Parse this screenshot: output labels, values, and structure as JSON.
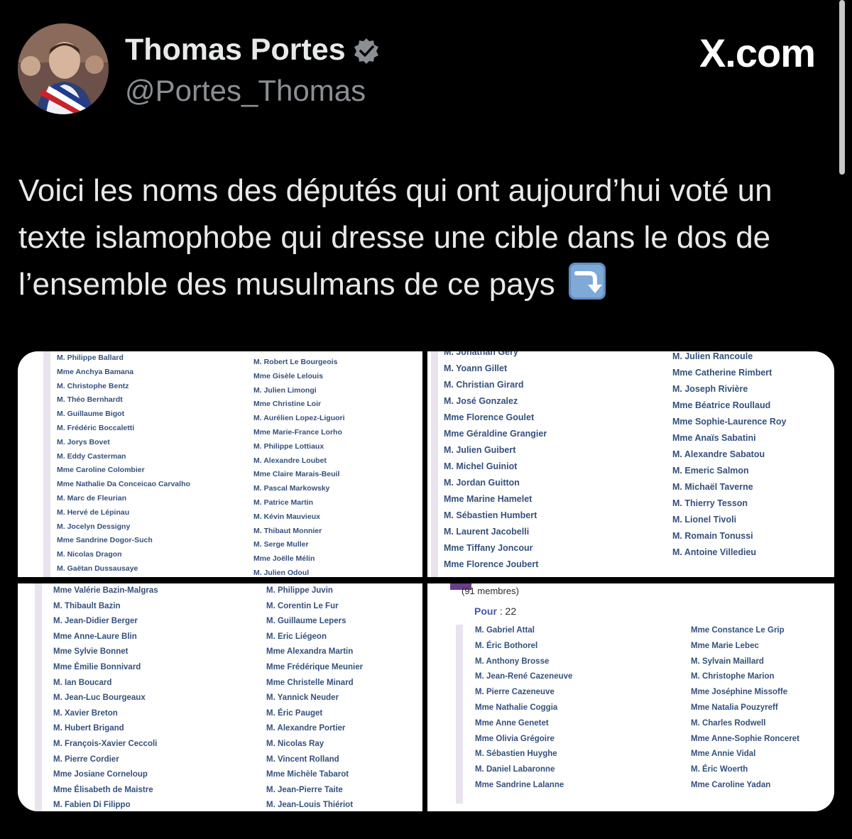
{
  "profile": {
    "display_name": "Thomas Portes",
    "handle": "@Portes_Thomas",
    "verified": true,
    "verified_icon": "verified-badge-icon"
  },
  "brand": "X.com",
  "tweet": {
    "text": "Voici les noms des députés qui ont aujourd’hui voté un texte islamophobe qui dresse une cible dans le dos de l’ensemble des musulmans de ce pays",
    "emoji": "arrow-right-curving-down-emoji"
  },
  "colors": {
    "background": "#000000",
    "text": "#e7e9ea",
    "handle": "#8b8f94",
    "list_names": "#35507e",
    "pour_label": "#4257a8"
  },
  "media": {
    "panel_1": {
      "left": [
        "M. Philippe Ballard",
        "Mme Anchya Bamana",
        "M. Christophe Bentz",
        "M. Théo Bernhardt",
        "M. Guillaume Bigot",
        "M. Frédéric Boccaletti",
        "M. Jorys Bovet",
        "M. Eddy Casterman",
        "Mme Caroline Colombier",
        "Mme Nathalie Da Conceicao Carvalho",
        "M. Marc de Fleurian",
        "M. Hervé de Lépinau",
        "M. Jocelyn Dessigny",
        "Mme Sandrine Dogor-Such",
        "M. Nicolas Dragon",
        "M. Gaëtan Dussausaye"
      ],
      "right": [
        "M. Robert Le Bourgeois",
        "Mme Gisèle Lelouis",
        "M. Julien Limongi",
        "Mme Christine Loir",
        "M. Aurélien Lopez-Liguori",
        "Mme Marie-France Lorho",
        "M. Philippe Lottiaux",
        "M. Alexandre Loubet",
        "Mme Claire Marais-Beuil",
        "M. Pascal Markowsky",
        "M. Patrice Martin",
        "M. Kévin Mauvieux",
        "M. Thibaut Monnier",
        "M. Serge Muller",
        "Mme Joëlle Mélin",
        "M. Julien Odoul"
      ]
    },
    "panel_2": {
      "left": [
        "M. Jonathan Gery",
        "M. Yoann Gillet",
        "M. Christian Girard",
        "M. José Gonzalez",
        "Mme Florence Goulet",
        "Mme Géraldine Grangier",
        "M. Julien Guibert",
        "M. Michel Guiniot",
        "M. Jordan Guitton",
        "Mme Marine Hamelet",
        "M. Sébastien Humbert",
        "M. Laurent Jacobelli",
        "Mme Tiffany Joncour",
        "Mme Florence Joubert"
      ],
      "right": [
        "M. Julien Rancoule",
        "Mme Catherine Rimbert",
        "M. Joseph Rivière",
        "Mme Béatrice Roullaud",
        "Mme Sophie-Laurence Roy",
        "Mme Anaïs Sabatini",
        "M. Alexandre Sabatou",
        "M. Emeric Salmon",
        "M. Michaël Taverne",
        "M. Thierry Tesson",
        "M. Lionel Tivoli",
        "M. Romain Tonussi",
        "M. Antoine Villedieu"
      ]
    },
    "panel_3": {
      "left": [
        "Mme Valérie Bazin-Malgras",
        "M. Thibault Bazin",
        "M. Jean-Didier Berger",
        "Mme Anne-Laure Blin",
        "Mme Sylvie Bonnet",
        "Mme Émilie Bonnivard",
        "M. Ian Boucard",
        "M. Jean-Luc Bourgeaux",
        "M. Xavier Breton",
        "M. Hubert Brigand",
        "M. François-Xavier Ceccoli",
        "M. Pierre Cordier",
        "Mme Josiane Corneloup",
        "Mme Élisabeth de Maistre",
        "M. Fabien Di Filippo"
      ],
      "right": [
        "M. Philippe Juvin",
        "M. Corentin Le Fur",
        "M. Guillaume Lepers",
        "M. Eric Liégeon",
        "Mme Alexandra Martin",
        "Mme Frédérique Meunier",
        "Mme Christelle Minard",
        "M. Yannick Neuder",
        "M. Éric Pauget",
        "M. Alexandre Portier",
        "M. Nicolas Ray",
        "M. Vincent Rolland",
        "Mme Michèle Tabarot",
        "M. Jean-Pierre Taite",
        "M. Jean-Louis Thiériot"
      ]
    },
    "panel_4": {
      "group_count": "(91 membres)",
      "pour_label": "Pour",
      "pour_count": ": 22",
      "left": [
        "M. Gabriel Attal",
        "M. Éric Bothorel",
        "M. Anthony Brosse",
        "M. Jean-René Cazeneuve",
        "M. Pierre Cazeneuve",
        "Mme Nathalie Coggia",
        "Mme Anne Genetet",
        "Mme Olivia Grégoire",
        "M. Sébastien Huyghe",
        "M. Daniel Labaronne",
        "Mme Sandrine Lalanne"
      ],
      "right": [
        "Mme Constance Le Grip",
        "Mme Marie Lebec",
        "M. Sylvain Maillard",
        "M. Christophe Marion",
        "Mme Joséphine Missoffe",
        "Mme Natalia Pouzyreff",
        "M. Charles Rodwell",
        "Mme Anne-Sophie Ronceret",
        "Mme Annie Vidal",
        "M. Éric Woerth",
        "Mme Caroline Yadan"
      ]
    }
  }
}
